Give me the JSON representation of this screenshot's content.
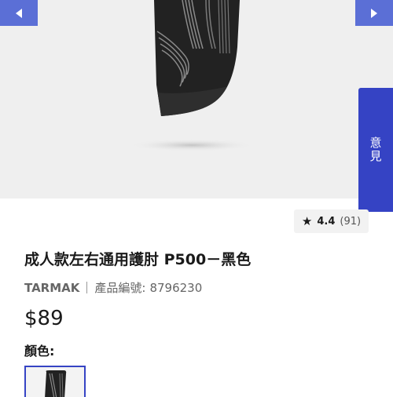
{
  "product": {
    "feedback_label": "意見",
    "rating": {
      "value": "4.4",
      "count": "(91)",
      "icon": "star-icon"
    },
    "title": "成人款左右通用護肘 P500－黑色",
    "brand": "TARMAK",
    "sku_label": "產品編號:",
    "sku_value": "8796230",
    "price": "$89",
    "color_label": "顏色:",
    "colors": [
      {
        "name": "black",
        "selected": true
      }
    ]
  },
  "gallery": {
    "prev_icon": "chevron-left-icon",
    "next_icon": "chevron-right-icon"
  },
  "theme": {
    "accent": "#3543c4",
    "nav_button": "#5b6fd6",
    "hero_bg": "#efefef"
  }
}
